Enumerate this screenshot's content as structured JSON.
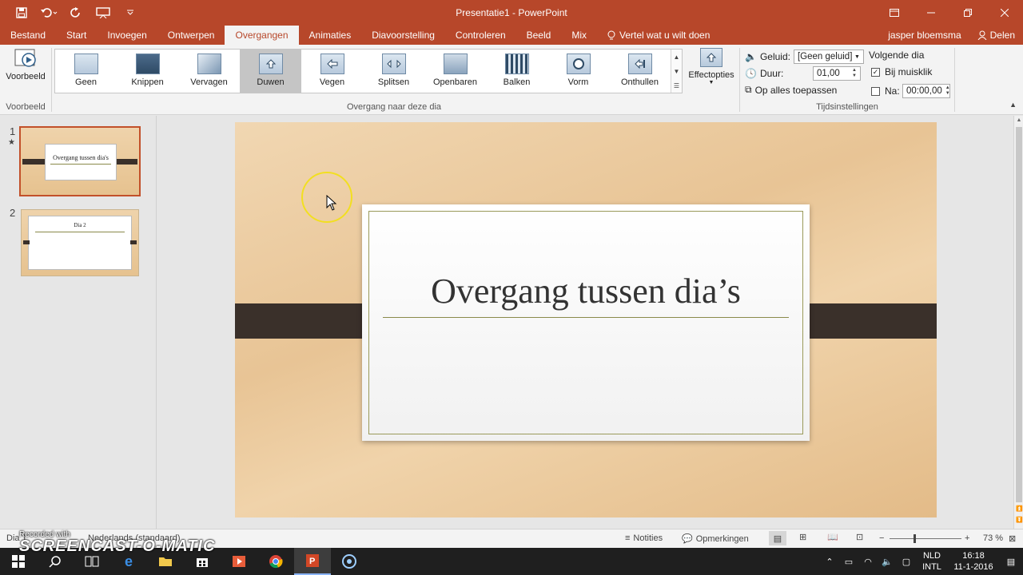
{
  "window": {
    "title": "Presentatie1 - PowerPoint"
  },
  "tabs": [
    {
      "label": "Bestand"
    },
    {
      "label": "Start"
    },
    {
      "label": "Invoegen"
    },
    {
      "label": "Ontwerpen"
    },
    {
      "label": "Overgangen"
    },
    {
      "label": "Animaties"
    },
    {
      "label": "Diavoorstelling"
    },
    {
      "label": "Controleren"
    },
    {
      "label": "Beeld"
    },
    {
      "label": "Mix"
    }
  ],
  "tell_me": "Vertel wat u wilt doen",
  "user": "jasper bloemsma",
  "share": "Delen",
  "ribbon": {
    "preview_label": "Voorbeeld",
    "preview_group": "Voorbeeld",
    "transitions": [
      {
        "label": "Geen"
      },
      {
        "label": "Knippen"
      },
      {
        "label": "Vervagen"
      },
      {
        "label": "Duwen"
      },
      {
        "label": "Vegen"
      },
      {
        "label": "Splitsen"
      },
      {
        "label": "Openbaren"
      },
      {
        "label": "Balken"
      },
      {
        "label": "Vorm"
      },
      {
        "label": "Onthullen"
      }
    ],
    "selected_transition": "Duwen",
    "transition_group": "Overgang naar deze dia",
    "effect_options": "Effectopties",
    "timing": {
      "sound_label": "Geluid:",
      "sound_value": "[Geen geluid]",
      "duration_label": "Duur:",
      "duration_value": "01,00",
      "apply_all": "Op alles toepassen",
      "next_slide": "Volgende dia",
      "on_click": "Bij muisklik",
      "on_click_checked": true,
      "after_label": "Na:",
      "after_value": "00:00,00",
      "after_checked": false,
      "group": "Tijdsinstellingen"
    }
  },
  "thumbnails": [
    {
      "number": "1",
      "star": "★",
      "title": "Overgang tussen dia's"
    },
    {
      "number": "2",
      "title": "Dia 2"
    }
  ],
  "slide": {
    "title": "Overgang tussen dia’s"
  },
  "statusbar": {
    "slide_info": "Dia 1",
    "language": "Nederlands (standaard)",
    "notes": "Notities",
    "comments": "Opmerkingen",
    "zoom": "73 %"
  },
  "taskbar": {
    "lang_top": "NLD",
    "lang_bottom": "INTL",
    "time": "16:18",
    "date": "11-1-2016"
  },
  "watermark": {
    "recorded_with": "Recorded with",
    "brand": "SCREENCAST-O-MATIC"
  },
  "colors": {
    "accent": "#b7472a",
    "selected_thumb_border": "#c2502a",
    "slide_band": "#3a302a"
  }
}
